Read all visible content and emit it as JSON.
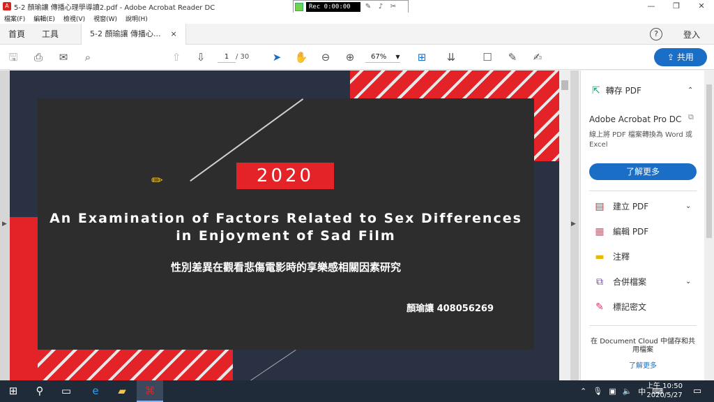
{
  "window": {
    "title": "5-2 顏瑜讓 傳播心理學導讀2.pdf - Adobe Acrobat Reader DC",
    "controls": [
      "—",
      "❐",
      "✕"
    ]
  },
  "recorder": {
    "label": "Rec 0:00:00"
  },
  "menu": [
    "檔案(F)",
    "編輯(E)",
    "檢視(V)",
    "視窗(W)",
    "說明(H)"
  ],
  "tabs": {
    "home": "首頁",
    "tools": "工具",
    "doc": "5-2 顏瑜讓 傳播心...",
    "close": "×",
    "signin": "登入",
    "help": "?"
  },
  "toolbar": {
    "page_current": "1",
    "page_total": "/ 30",
    "zoom": "67%",
    "share_label": "共用"
  },
  "slide": {
    "year": "2020",
    "title_line1": "An Examination of Factors Related to Sex Differences",
    "title_line2": "in Enjoyment of Sad Film",
    "title_zh": "性別差異在觀看悲傷電影時的享樂感相關因素研究",
    "author": "顏瑜讓 408056269"
  },
  "right_pane": {
    "export_label": "轉存 PDF",
    "product": "Adobe Acrobat Pro DC",
    "description": "線上將 PDF 檔案轉換為 Word 或 Excel",
    "learn_more": "了解更多",
    "tools": [
      {
        "label": "建立 PDF",
        "icon": "create-pdf-icon"
      },
      {
        "label": "編輯 PDF",
        "icon": "edit-pdf-icon"
      },
      {
        "label": "注釋",
        "icon": "comment-icon"
      },
      {
        "label": "合併檔案",
        "icon": "combine-icon"
      },
      {
        "label": "標記密文",
        "icon": "redact-icon"
      }
    ],
    "cloud_text": "在 Document Cloud 中儲存和共用檔案",
    "cloud_link": "了解更多"
  },
  "taskbar": {
    "clock_time": "上午 10:50",
    "clock_date": "2020/5/27",
    "ime": "中"
  }
}
